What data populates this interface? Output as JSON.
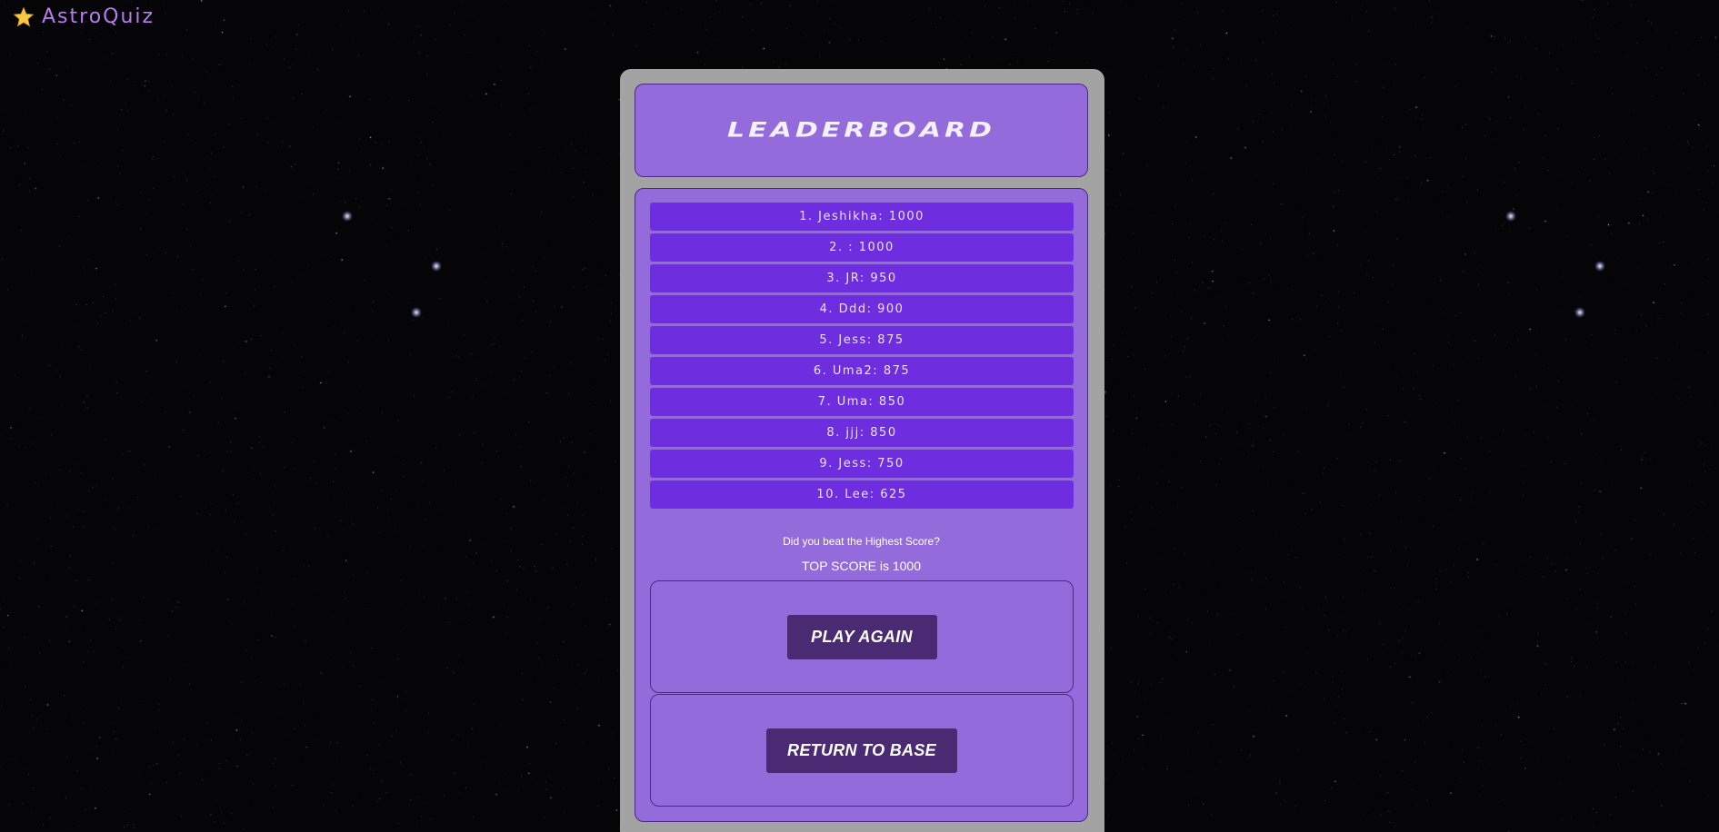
{
  "app": {
    "name": "AstroQuiz",
    "logo_icon": "star-icon",
    "accent_color": "#b77bf0"
  },
  "header": {
    "title": "LEADERBOARD"
  },
  "leaderboard": {
    "entries": [
      "1. Jeshikha: 1000",
      "2. : 1000",
      "3. JR: 950",
      "4. Ddd: 900",
      "5. Jess: 875",
      "6. Uma2: 875",
      "7. Uma: 850",
      "8. jjj: 850",
      "9. Jess: 750",
      "10. Lee: 625"
    ]
  },
  "prompt": "Did you beat the Highest Score?",
  "top_score": "TOP SCORE is 1000",
  "actions": {
    "play_again_label": "PLAY AGAIN",
    "return_label": "RETURN TO BASE"
  },
  "colors": {
    "background": "#050507",
    "panel": "#a3a3a3",
    "card": "#936bdb",
    "row": "#6e2ee0",
    "button": "#4a2a73"
  }
}
